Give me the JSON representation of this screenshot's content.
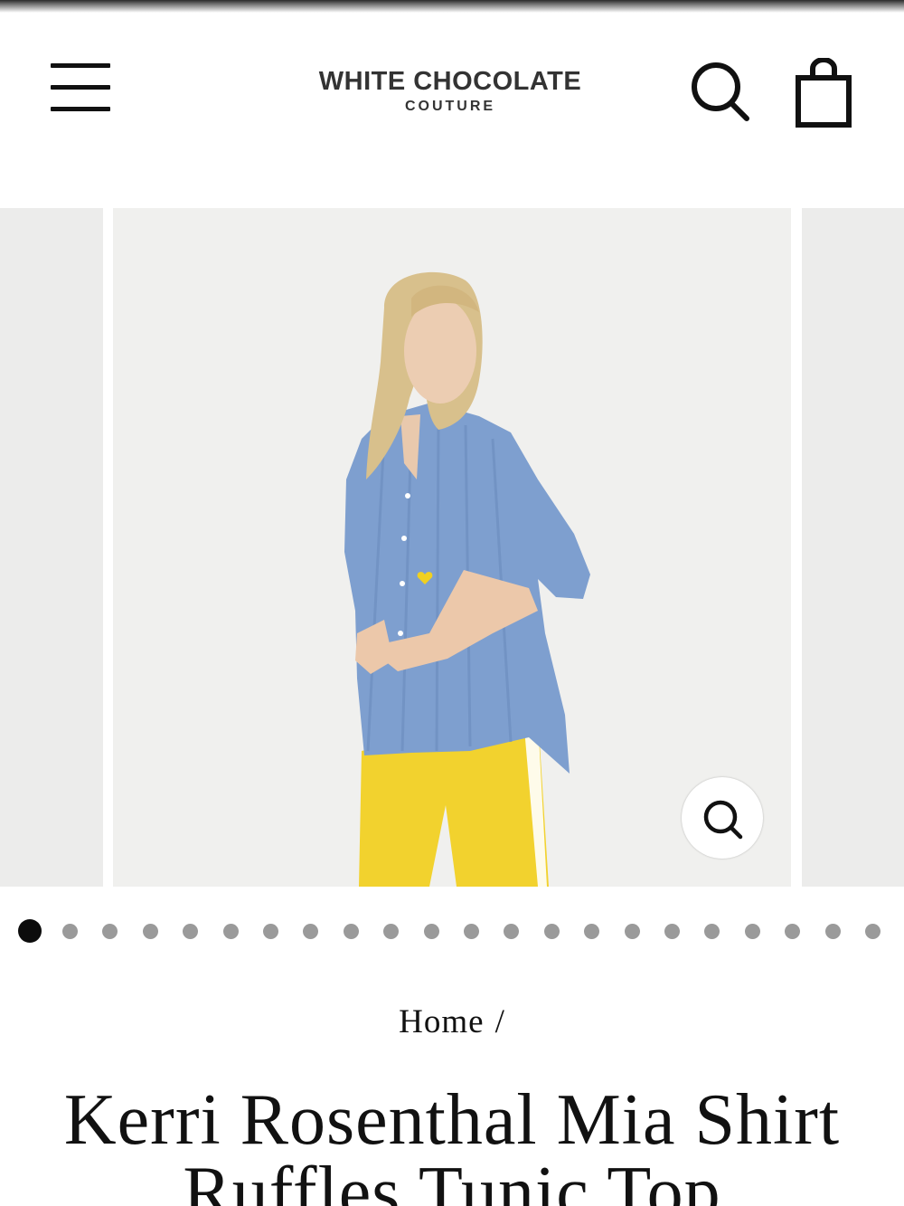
{
  "header": {
    "menu_icon": "hamburger-menu-icon",
    "logo_line1": "WHITE CHOCOLATE",
    "logo_line2": "COUTURE",
    "search_icon": "search-icon",
    "cart_icon": "shopping-bag-icon"
  },
  "gallery": {
    "zoom_icon": "magnifier-icon",
    "slide_count": 22,
    "active_slide": 1,
    "colors": {
      "shirt": "#7e9fcf",
      "pants": "#f2d22e",
      "background": "#f0f0ee"
    }
  },
  "breadcrumb": {
    "home": "Home",
    "separator": "/"
  },
  "product": {
    "title": "Kerri Rosenthal Mia Shirt Ruffles Tunic Top"
  }
}
